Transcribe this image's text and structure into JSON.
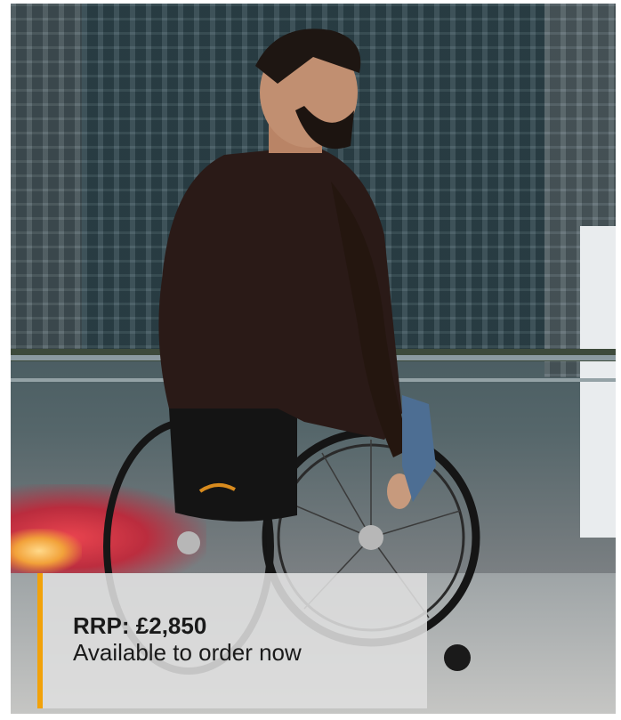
{
  "product_card": {
    "image": {
      "description_icon": "wheelchair-user-photo-icon"
    },
    "info": {
      "price": "RRP: £2,850",
      "availability": "Available to order now"
    },
    "colors": {
      "accent": "#f2a20a",
      "overlay": "#dedede"
    }
  }
}
